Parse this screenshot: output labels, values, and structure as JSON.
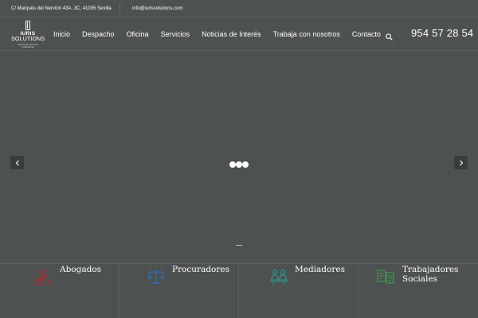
{
  "topbar": {
    "address": "C/ Marqués del Nervión 43A, 3C, 41005 Sevilla",
    "email": "info@iurissolutions.com"
  },
  "logo": {
    "line1": "IURIS",
    "line2": "SOLUTIONS",
    "tagline": "SERVICIOS LEGALES INTEGRALES"
  },
  "nav": {
    "items": [
      {
        "label": "Inicio"
      },
      {
        "label": "Despacho"
      },
      {
        "label": "Oficina"
      },
      {
        "label": "Servicios"
      },
      {
        "label": "Noticias de Interés"
      },
      {
        "label": "Trabaja con nosotros"
      },
      {
        "label": "Contacto"
      }
    ]
  },
  "phone": "954 57 28 54",
  "services": [
    {
      "label": "Abogados",
      "icon": "lawyer-icon",
      "color": "#c0272d"
    },
    {
      "label": "Procuradores",
      "icon": "scales-icon",
      "color": "#2e6fb5"
    },
    {
      "label": "Mediadores",
      "icon": "people-meeting-icon",
      "color": "#2a9d8f"
    },
    {
      "label": "Trabajadores Sociales",
      "icon": "documents-icon",
      "color": "#3aa34a"
    }
  ],
  "colors": {
    "background": "#4d5150",
    "text": "#ffffff"
  }
}
